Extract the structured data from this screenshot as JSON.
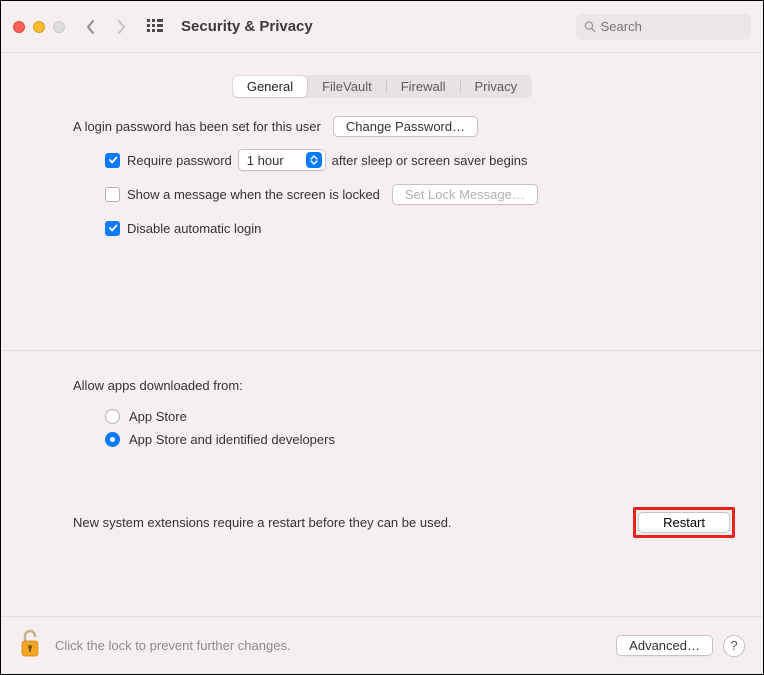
{
  "window": {
    "title": "Security & Privacy"
  },
  "search": {
    "placeholder": "Search"
  },
  "tabs": {
    "general": "General",
    "filevault": "FileVault",
    "firewall": "Firewall",
    "privacy": "Privacy"
  },
  "login": {
    "password_set_text": "A login password has been set for this user",
    "change_password_btn": "Change Password…",
    "require_password_label": "Require password",
    "require_password_checked": true,
    "delay_value": "1 hour",
    "after_sleep_text": "after sleep or screen saver begins",
    "show_message_label": "Show a message when the screen is locked",
    "show_message_checked": false,
    "set_lock_message_btn": "Set Lock Message…",
    "disable_auto_login_label": "Disable automatic login",
    "disable_auto_login_checked": true
  },
  "allow": {
    "heading": "Allow apps downloaded from:",
    "app_store": "App Store",
    "app_store_identified": "App Store and identified developers",
    "selected": "app_store_identified"
  },
  "extensions": {
    "message": "New system extensions require a restart before they can be used.",
    "restart_btn": "Restart"
  },
  "footer": {
    "lock_text": "Click the lock to prevent further changes.",
    "advanced_btn": "Advanced…",
    "help": "?"
  }
}
